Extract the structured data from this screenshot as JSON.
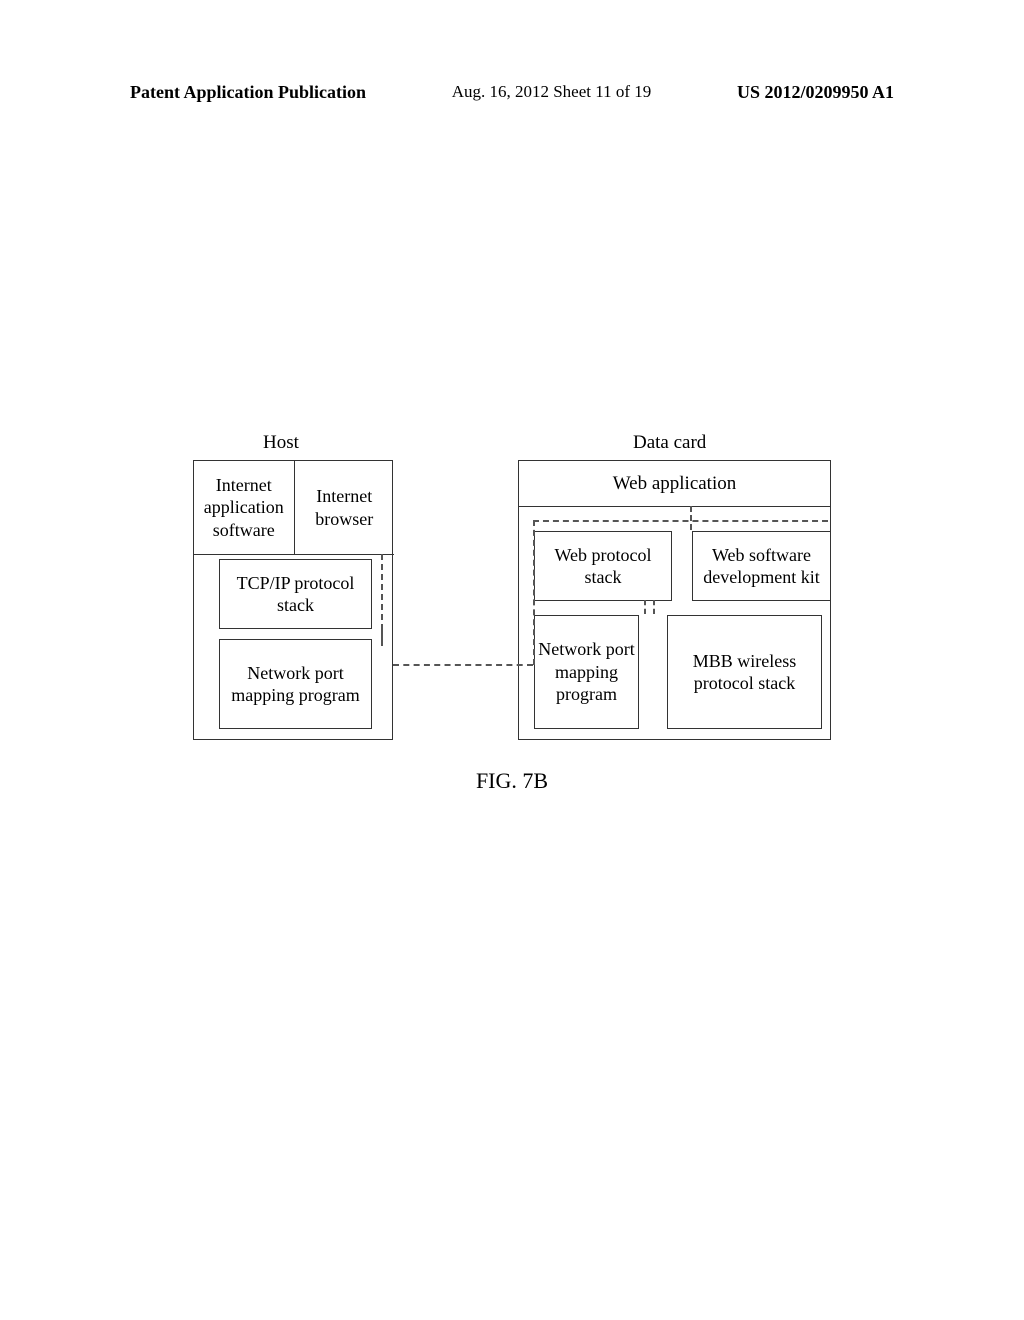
{
  "header": {
    "left": "Patent Application Publication",
    "center": "Aug. 16, 2012  Sheet 11 of 19",
    "right": "US 2012/0209950 A1"
  },
  "diagram": {
    "host_title": "Host",
    "datacard_title": "Data card",
    "host": {
      "internet_app": "Internet application software",
      "internet_browser": "Internet browser",
      "tcpip": "TCP/IP protocol stack",
      "netport": "Network port mapping program"
    },
    "datacard": {
      "web_app": "Web application",
      "web_proto": "Web protocol stack",
      "web_sdk": "Web software development kit",
      "netport": "Network port mapping program",
      "mbb": "MBB wireless protocol stack"
    }
  },
  "figure_label": "FIG. 7B"
}
